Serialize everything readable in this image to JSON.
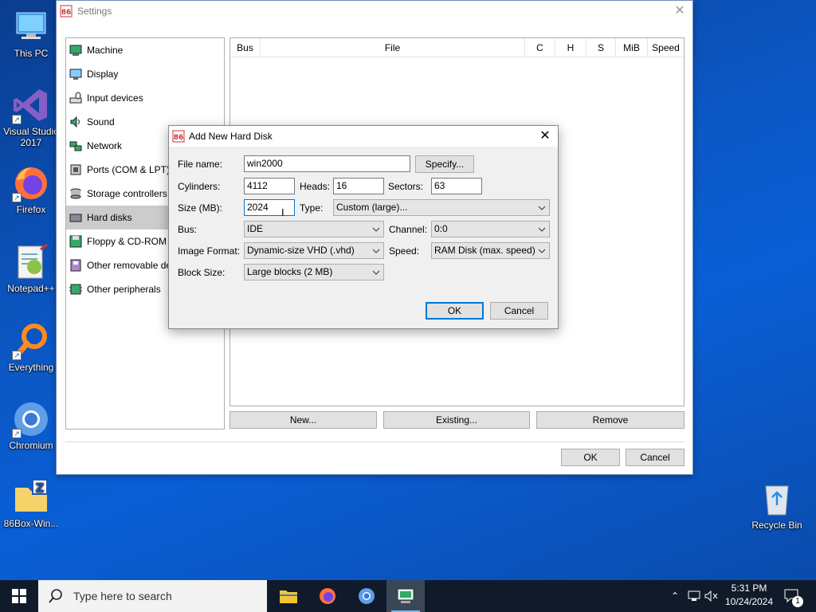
{
  "desktop": {
    "icons": [
      {
        "label": "This PC"
      },
      {
        "label": "Visual Studio 2017"
      },
      {
        "label": "Firefox"
      },
      {
        "label": "Notepad++"
      },
      {
        "label": "Everything"
      },
      {
        "label": "Chromium"
      },
      {
        "label": "86Box-Win..."
      },
      {
        "label": "Recycle Bin"
      }
    ]
  },
  "settings": {
    "title": "Settings",
    "categories": [
      {
        "label": "Machine",
        "icon": "machine-icon"
      },
      {
        "label": "Display",
        "icon": "display-icon"
      },
      {
        "label": "Input devices",
        "icon": "input-devices-icon"
      },
      {
        "label": "Sound",
        "icon": "sound-icon"
      },
      {
        "label": "Network",
        "icon": "network-icon"
      },
      {
        "label": "Ports (COM & LPT)",
        "icon": "ports-icon"
      },
      {
        "label": "Storage controllers",
        "icon": "storage-icon"
      },
      {
        "label": "Hard disks",
        "icon": "hard-disk-icon",
        "selected": true
      },
      {
        "label": "Floppy & CD-ROM drives",
        "icon": "floppy-icon"
      },
      {
        "label": "Other removable devices",
        "icon": "removable-icon"
      },
      {
        "label": "Other peripherals",
        "icon": "peripherals-icon"
      }
    ],
    "table_headers": [
      "Bus",
      "File",
      "C",
      "H",
      "S",
      "MiB",
      "Speed"
    ],
    "new_label": "New...",
    "existing_label": "Existing...",
    "remove_label": "Remove",
    "ok_label": "OK",
    "cancel_label": "Cancel"
  },
  "dialog": {
    "title": "Add New Hard Disk",
    "file_name_label": "File name:",
    "file_name_value": "win2000",
    "specify_label": "Specify...",
    "cylinders_label": "Cylinders:",
    "cylinders_value": "4112",
    "heads_label": "Heads:",
    "heads_value": "16",
    "sectors_label": "Sectors:",
    "sectors_value": "63",
    "size_label": "Size (MB):",
    "size_value": "2024",
    "type_label": "Type:",
    "type_value": "Custom (large)...",
    "bus_label": "Bus:",
    "bus_value": "IDE",
    "channel_label": "Channel:",
    "channel_value": "0:0",
    "image_format_label": "Image Format:",
    "image_format_value": "Dynamic-size VHD (.vhd)",
    "speed_label": "Speed:",
    "speed_value": "RAM Disk (max. speed)",
    "block_size_label": "Block Size:",
    "block_size_value": "Large blocks (2 MB)",
    "ok_label": "OK",
    "cancel_label": "Cancel"
  },
  "taskbar": {
    "search_placeholder": "Type here to search",
    "time": "5:31 PM",
    "date": "10/24/2024",
    "notification_count": "1"
  },
  "colors": {
    "accent": "#0078d7",
    "selected_item": "#cccccc",
    "taskbar": "#101a2a"
  }
}
